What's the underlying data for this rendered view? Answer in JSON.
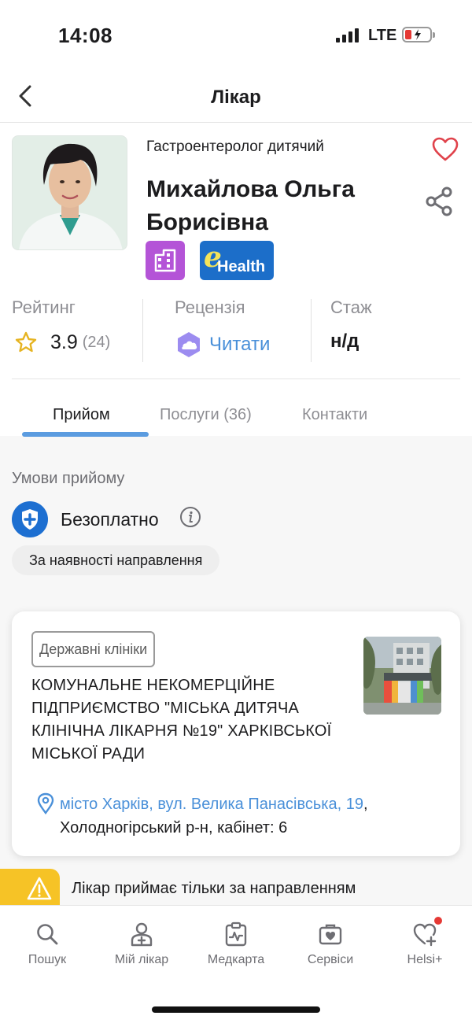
{
  "status_bar": {
    "time": "14:08",
    "network": "LTE"
  },
  "nav": {
    "title": "Лікар"
  },
  "doctor": {
    "specialty": "Гастроентеролог дитячий",
    "name": "Михайлова Ольга Борисівна",
    "ehealth_badge": {
      "prefix": "e",
      "word": "Health"
    }
  },
  "stats": {
    "rating": {
      "label": "Рейтинг",
      "value": "3.9",
      "count": "(24)"
    },
    "review": {
      "label": "Рецензія",
      "value": "Читати"
    },
    "experience": {
      "label": "Стаж",
      "value": "н/д"
    }
  },
  "tabs": [
    {
      "label": "Прийом",
      "active": true
    },
    {
      "label": "Послуги (36)",
      "active": false
    },
    {
      "label": "Контакти",
      "active": false
    }
  ],
  "conditions": {
    "title": "Умови прийому",
    "payment": "Безоплатно",
    "referral": "За наявності направлення"
  },
  "clinic": {
    "type": "Державні клініки",
    "name": "КОМУНАЛЬНЕ НЕКОМЕРЦІЙНЕ ПІДПРИЄМСТВО \"МІСЬКА ДИТЯЧА КЛІНІЧНА ЛІКАРНЯ №19\" ХАРКІВСЬКОЇ МІСЬКОЇ РАДИ",
    "address_link": "місто Харків, вул. Велика Панасівська, 19",
    "address_sep": ",",
    "address_rest": "Холодногірський р-н, кабінет: 6"
  },
  "warning": {
    "text": "Лікар приймає тільки за направленням"
  },
  "tab_bar": [
    {
      "label": "Пошук",
      "icon": "search-icon"
    },
    {
      "label": "Мій лікар",
      "icon": "doctor-icon"
    },
    {
      "label": "Медкарта",
      "icon": "medical-card-icon"
    },
    {
      "label": "Сервіси",
      "icon": "medkit-icon"
    },
    {
      "label": "Helsi+",
      "icon": "heart-plus-icon"
    }
  ],
  "colors": {
    "accent_blue": "#4a90d9",
    "heart_red": "#e0424b",
    "clinic_badge": "#b454d7",
    "ehealth_badge": "#1c6ec9",
    "warning_yellow": "#f6c326"
  }
}
